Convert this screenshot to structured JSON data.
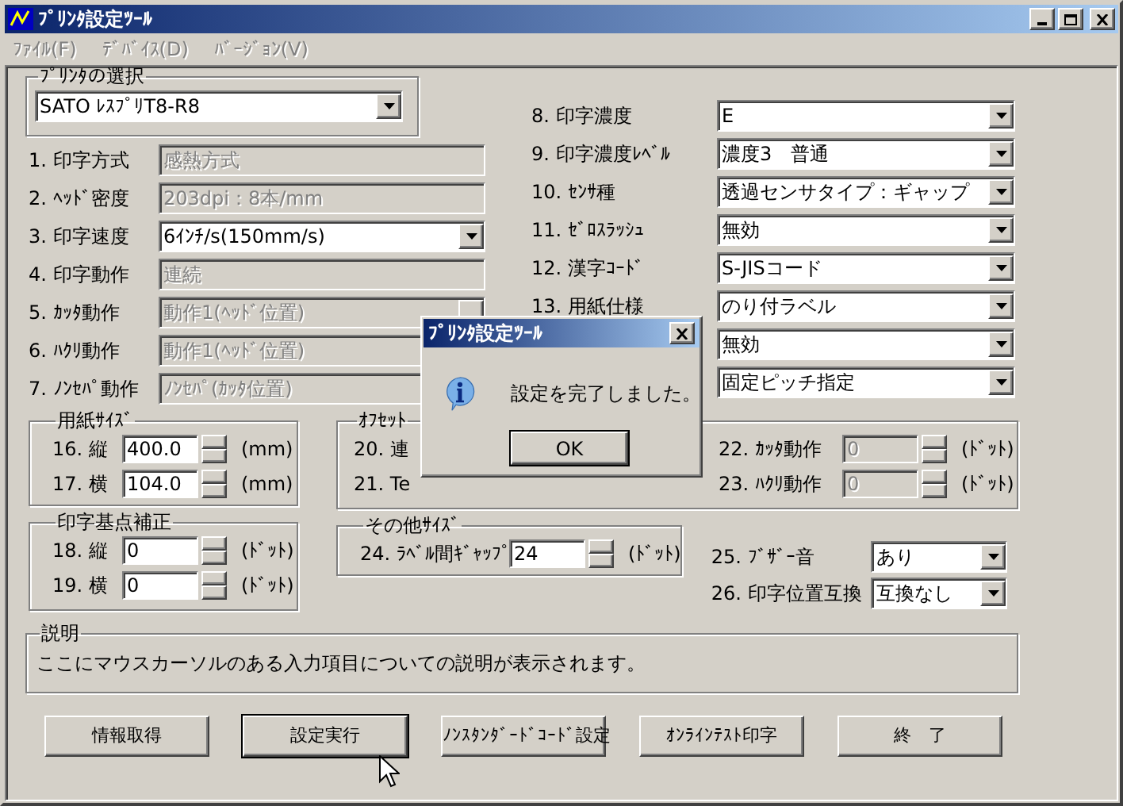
{
  "window": {
    "title": "ﾌﾟﾘﾝﾀ設定ﾂｰﾙ"
  },
  "menu": [
    {
      "label": "ﾌｧｲﾙ(F)",
      "disabled": true
    },
    {
      "label": "ﾃﾞﾊﾞｲｽ(D)",
      "disabled": true
    },
    {
      "label": "ﾊﾞｰｼﾞｮﾝ(V)",
      "disabled": true
    }
  ],
  "printer_group": {
    "title": "ﾌﾟﾘﾝﾀの選択",
    "value": "SATO ﾚｽﾌﾟﾘT8-R8"
  },
  "left_settings": [
    {
      "label": "1. 印字方式",
      "kind": "text",
      "value": "感熱方式",
      "disabled": true
    },
    {
      "label": "2. ﾍｯﾄﾞ密度",
      "kind": "text",
      "value": "203dpi：8本/mm",
      "disabled": true
    },
    {
      "label": "3. 印字速度",
      "kind": "dropdown",
      "value": "6ｲﾝﾁ/s(150mm/s)",
      "disabled": false
    },
    {
      "label": "4. 印字動作",
      "kind": "text",
      "value": "連続",
      "disabled": true
    },
    {
      "label": "5. ｶｯﾀ動作",
      "kind": "dropdown",
      "value": "動作1(ﾍｯﾄﾞ位置)",
      "disabled": true
    },
    {
      "label": "6. ﾊｸﾘ動作",
      "kind": "dropdown",
      "value": "動作1(ﾍｯﾄﾞ位置)",
      "disabled": true
    },
    {
      "label": "7. ﾉﾝｾﾊﾟ動作",
      "kind": "dropdown",
      "value": "ﾉﾝｾﾊﾟ(ｶｯﾀ位置)",
      "disabled": true
    }
  ],
  "right_settings": [
    {
      "label": "8. 印字濃度",
      "value": "E"
    },
    {
      "label": "9. 印字濃度ﾚﾍﾞﾙ",
      "value": "濃度3　普通"
    },
    {
      "label": "10. ｾﾝｻ種",
      "value": "透過センサタイプ：ギャップ"
    },
    {
      "label": "11. ｾﾞﾛｽﾗｯｼｭ",
      "value": "無効"
    },
    {
      "label": "12. 漢字ｺｰﾄﾞ",
      "value": "S-JISコード"
    },
    {
      "label": "13. 用紙仕様",
      "value": "のり付ラベル"
    },
    {
      "value": "無効"
    },
    {
      "value": "固定ピッチ指定"
    }
  ],
  "paper_size": {
    "title": "用紙ｻｲｽﾞ",
    "rows": [
      {
        "label": "16. 縦",
        "value": "400.0",
        "unit": "(mm)"
      },
      {
        "label": "17. 横",
        "value": "104.0",
        "unit": "(mm)"
      }
    ]
  },
  "base_point": {
    "title": "印字基点補正",
    "rows": [
      {
        "label": "18. 縦",
        "value": "0",
        "unit": "(ﾄﾞｯﾄ)"
      },
      {
        "label": "19. 横",
        "value": "0",
        "unit": "(ﾄﾞｯﾄ)"
      }
    ]
  },
  "offset": {
    "title": "ｵﾌｾｯﾄ",
    "left_labels": [
      "20. 連",
      "21. Te"
    ],
    "rows": [
      {
        "label": "22. ｶｯﾀ動作",
        "value": "0",
        "unit": "(ﾄﾞｯﾄ)",
        "disabled": true
      },
      {
        "label": "23. ﾊｸﾘ動作",
        "value": "0",
        "unit": "(ﾄﾞｯﾄ)",
        "disabled": true
      }
    ]
  },
  "other_size": {
    "title": "その他ｻｲｽﾞ",
    "label": "24. ﾗﾍﾞﾙ間ｷﾞｬｯﾌﾟ",
    "value": "24",
    "unit": "(ﾄﾞｯﾄ)"
  },
  "extra_settings": [
    {
      "label": "25. ﾌﾞｻﾞｰ音",
      "value": "あり"
    },
    {
      "label": "26. 印字位置互換",
      "value": "互換なし"
    }
  ],
  "description": {
    "title": "説明",
    "text": "ここにマウスカーソルのある入力項目についての説明が表示されます。"
  },
  "buttons": [
    {
      "label": "情報取得",
      "focused": false
    },
    {
      "label": "設定実行",
      "focused": true
    },
    {
      "label": "ﾉﾝｽﾀﾝﾀﾞｰﾄﾞｺｰﾄﾞ設定",
      "focused": false
    },
    {
      "label": "ｵﾝﾗｲﾝﾃｽﾄ印字",
      "focused": false
    },
    {
      "label": "終　了",
      "focused": false
    }
  ],
  "dialog": {
    "title": "ﾌﾟﾘﾝﾀ設定ﾂｰﾙ",
    "message": "設定を完了しました。",
    "button": "OK"
  }
}
